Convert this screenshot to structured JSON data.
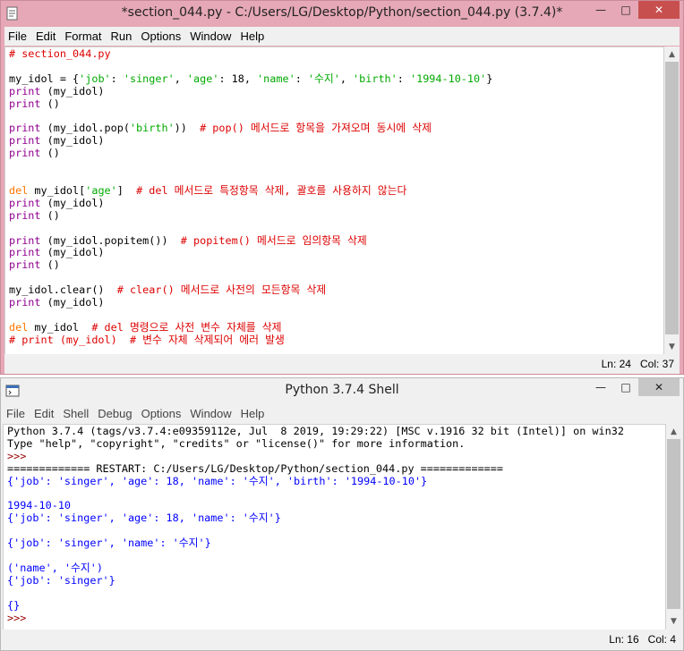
{
  "editor": {
    "title": "*section_044.py - C:/Users/LG/Desktop/Python/section_044.py (3.7.4)*",
    "menu": [
      "File",
      "Edit",
      "Format",
      "Run",
      "Options",
      "Window",
      "Help"
    ],
    "status": "Ln: 24   Col: 37",
    "lines": [
      [
        {
          "c": "cm",
          "t": "# section_044.py"
        }
      ],
      [],
      [
        {
          "c": "nm",
          "t": "my_idol = {"
        },
        {
          "c": "st",
          "t": "'job'"
        },
        {
          "c": "nm",
          "t": ": "
        },
        {
          "c": "st",
          "t": "'singer'"
        },
        {
          "c": "nm",
          "t": ", "
        },
        {
          "c": "st",
          "t": "'age'"
        },
        {
          "c": "nm",
          "t": ": 18, "
        },
        {
          "c": "st",
          "t": "'name'"
        },
        {
          "c": "nm",
          "t": ": "
        },
        {
          "c": "st",
          "t": "'수지'"
        },
        {
          "c": "nm",
          "t": ", "
        },
        {
          "c": "st",
          "t": "'birth'"
        },
        {
          "c": "nm",
          "t": ": "
        },
        {
          "c": "st",
          "t": "'1994-10-10'"
        },
        {
          "c": "nm",
          "t": "}"
        }
      ],
      [
        {
          "c": "bi",
          "t": "print"
        },
        {
          "c": "nm",
          "t": " (my_idol)"
        }
      ],
      [
        {
          "c": "bi",
          "t": "print"
        },
        {
          "c": "nm",
          "t": " ()"
        }
      ],
      [],
      [
        {
          "c": "bi",
          "t": "print"
        },
        {
          "c": "nm",
          "t": " (my_idol.pop("
        },
        {
          "c": "st",
          "t": "'birth'"
        },
        {
          "c": "nm",
          "t": "))  "
        },
        {
          "c": "cm",
          "t": "# pop() 메서드로 항목을 가져오며 동시에 삭제"
        }
      ],
      [
        {
          "c": "bi",
          "t": "print"
        },
        {
          "c": "nm",
          "t": " (my_idol)"
        }
      ],
      [
        {
          "c": "bi",
          "t": "print"
        },
        {
          "c": "nm",
          "t": " ()"
        }
      ],
      [],
      [],
      [
        {
          "c": "kw",
          "t": "del"
        },
        {
          "c": "nm",
          "t": " my_idol["
        },
        {
          "c": "st",
          "t": "'age'"
        },
        {
          "c": "nm",
          "t": "]  "
        },
        {
          "c": "cm",
          "t": "# del 메서드로 특정항목 삭제, 괄호를 사용하지 않는다"
        }
      ],
      [
        {
          "c": "bi",
          "t": "print"
        },
        {
          "c": "nm",
          "t": " (my_idol)"
        }
      ],
      [
        {
          "c": "bi",
          "t": "print"
        },
        {
          "c": "nm",
          "t": " ()"
        }
      ],
      [],
      [
        {
          "c": "bi",
          "t": "print"
        },
        {
          "c": "nm",
          "t": " (my_idol.popitem())  "
        },
        {
          "c": "cm",
          "t": "# popitem() 메서드로 임의항목 삭제"
        }
      ],
      [
        {
          "c": "bi",
          "t": "print"
        },
        {
          "c": "nm",
          "t": " (my_idol)"
        }
      ],
      [
        {
          "c": "bi",
          "t": "print"
        },
        {
          "c": "nm",
          "t": " ()"
        }
      ],
      [],
      [
        {
          "c": "nm",
          "t": "my_idol.clear()  "
        },
        {
          "c": "cm",
          "t": "# clear() 메서드로 사전의 모든항목 삭제"
        }
      ],
      [
        {
          "c": "bi",
          "t": "print"
        },
        {
          "c": "nm",
          "t": " (my_idol)"
        }
      ],
      [],
      [
        {
          "c": "kw",
          "t": "del"
        },
        {
          "c": "nm",
          "t": " my_idol  "
        },
        {
          "c": "cm",
          "t": "# del 명령으로 사전 변수 자체를 삭제"
        }
      ],
      [
        {
          "c": "cm",
          "t": "# print (my_idol)  # 변수 자체 삭제되어 에러 발생"
        }
      ]
    ]
  },
  "shell": {
    "title": "Python 3.7.4 Shell",
    "menu": [
      "File",
      "Edit",
      "Shell",
      "Debug",
      "Options",
      "Window",
      "Help"
    ],
    "status": "Ln: 16   Col: 4",
    "lines": [
      [
        {
          "c": "plain",
          "t": "Python 3.7.4 (tags/v3.7.4:e09359112e, Jul  8 2019, 19:29:22) [MSC v.1916 32 bit (Intel)] on win32"
        }
      ],
      [
        {
          "c": "plain",
          "t": "Type \"help\", \"copyright\", \"credits\" or \"license()\" for more information."
        }
      ],
      [
        {
          "c": "prompt",
          "t": ">>> "
        }
      ],
      [
        {
          "c": "plain",
          "t": "============= RESTART: C:/Users/LG/Desktop/Python/section_044.py ============="
        }
      ],
      [
        {
          "c": "out",
          "t": "{'job': 'singer', 'age': 18, 'name': '수지', 'birth': '1994-10-10'}"
        }
      ],
      [],
      [
        {
          "c": "out",
          "t": "1994-10-10"
        }
      ],
      [
        {
          "c": "out",
          "t": "{'job': 'singer', 'age': 18, 'name': '수지'}"
        }
      ],
      [],
      [
        {
          "c": "out",
          "t": "{'job': 'singer', 'name': '수지'}"
        }
      ],
      [],
      [
        {
          "c": "out",
          "t": "('name', '수지')"
        }
      ],
      [
        {
          "c": "out",
          "t": "{'job': 'singer'}"
        }
      ],
      [],
      [
        {
          "c": "out",
          "t": "{}"
        }
      ],
      [
        {
          "c": "prompt",
          "t": ">>> "
        }
      ]
    ]
  }
}
